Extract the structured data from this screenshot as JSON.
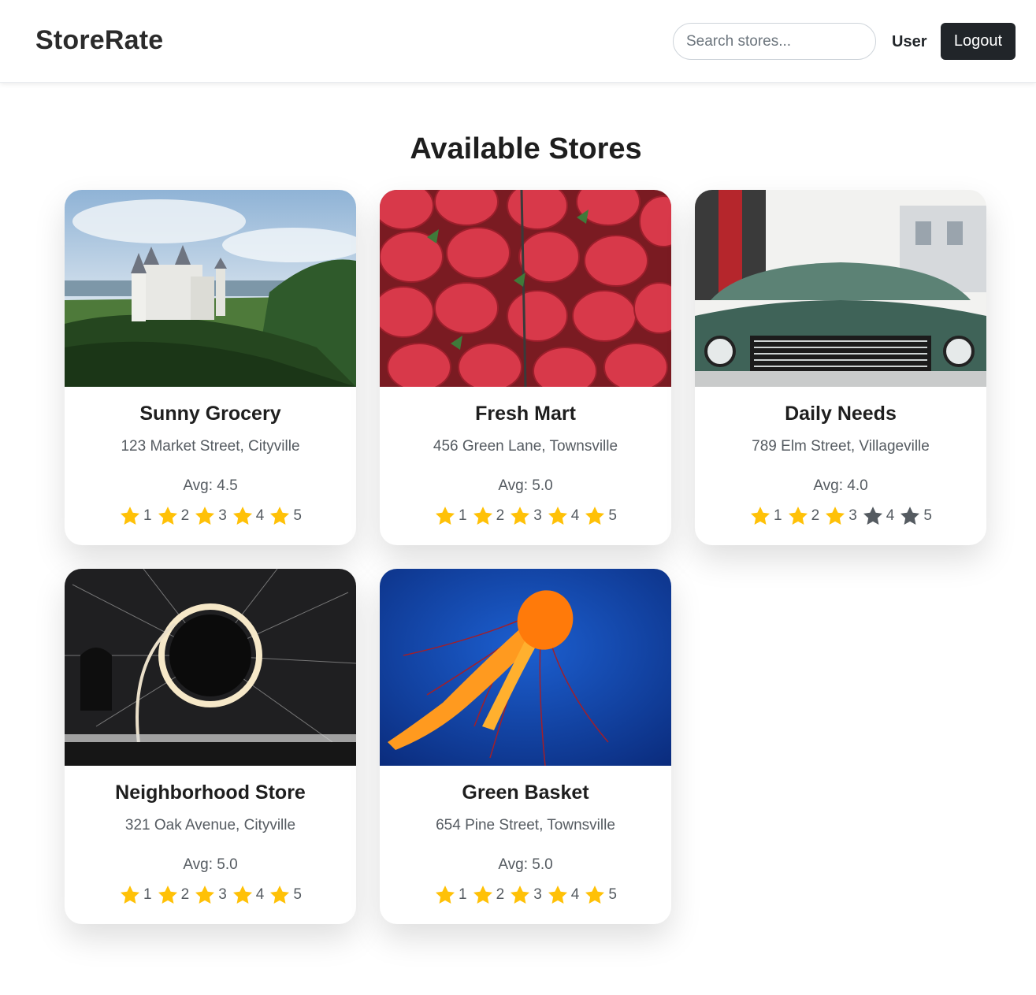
{
  "app": {
    "title": "StoreRate"
  },
  "header": {
    "search_placeholder": "Search stores...",
    "search_value": "",
    "user_label": "User",
    "logout_label": "Logout"
  },
  "main": {
    "title": "Available Stores"
  },
  "colors": {
    "star_filled": "#ffc107",
    "star_empty": "#555b61",
    "logout_bg": "#212529"
  },
  "stores": [
    {
      "name": "Sunny Grocery",
      "address": "123 Market Street, Cityville",
      "avg": "Avg: 4.5",
      "image": "castle-on-forested-hill",
      "rating": 5
    },
    {
      "name": "Fresh Mart",
      "address": "456 Green Lane, Townsville",
      "avg": "Avg: 5.0",
      "image": "strawberries",
      "rating": 5
    },
    {
      "name": "Daily Needs",
      "address": "789 Elm Street, Villageville",
      "avg": "Avg: 4.0",
      "image": "vintage-green-car",
      "rating": 3
    },
    {
      "name": "Neighborhood Store",
      "address": "321 Oak Avenue, Cityville",
      "avg": "Avg: 5.0",
      "image": "light-painting-ring",
      "rating": 5
    },
    {
      "name": "Green Basket",
      "address": "654 Pine Street, Townsville",
      "avg": "Avg: 5.0",
      "image": "orange-jellyfish",
      "rating": 5
    }
  ],
  "star_labels": [
    "1",
    "2",
    "3",
    "4",
    "5"
  ]
}
